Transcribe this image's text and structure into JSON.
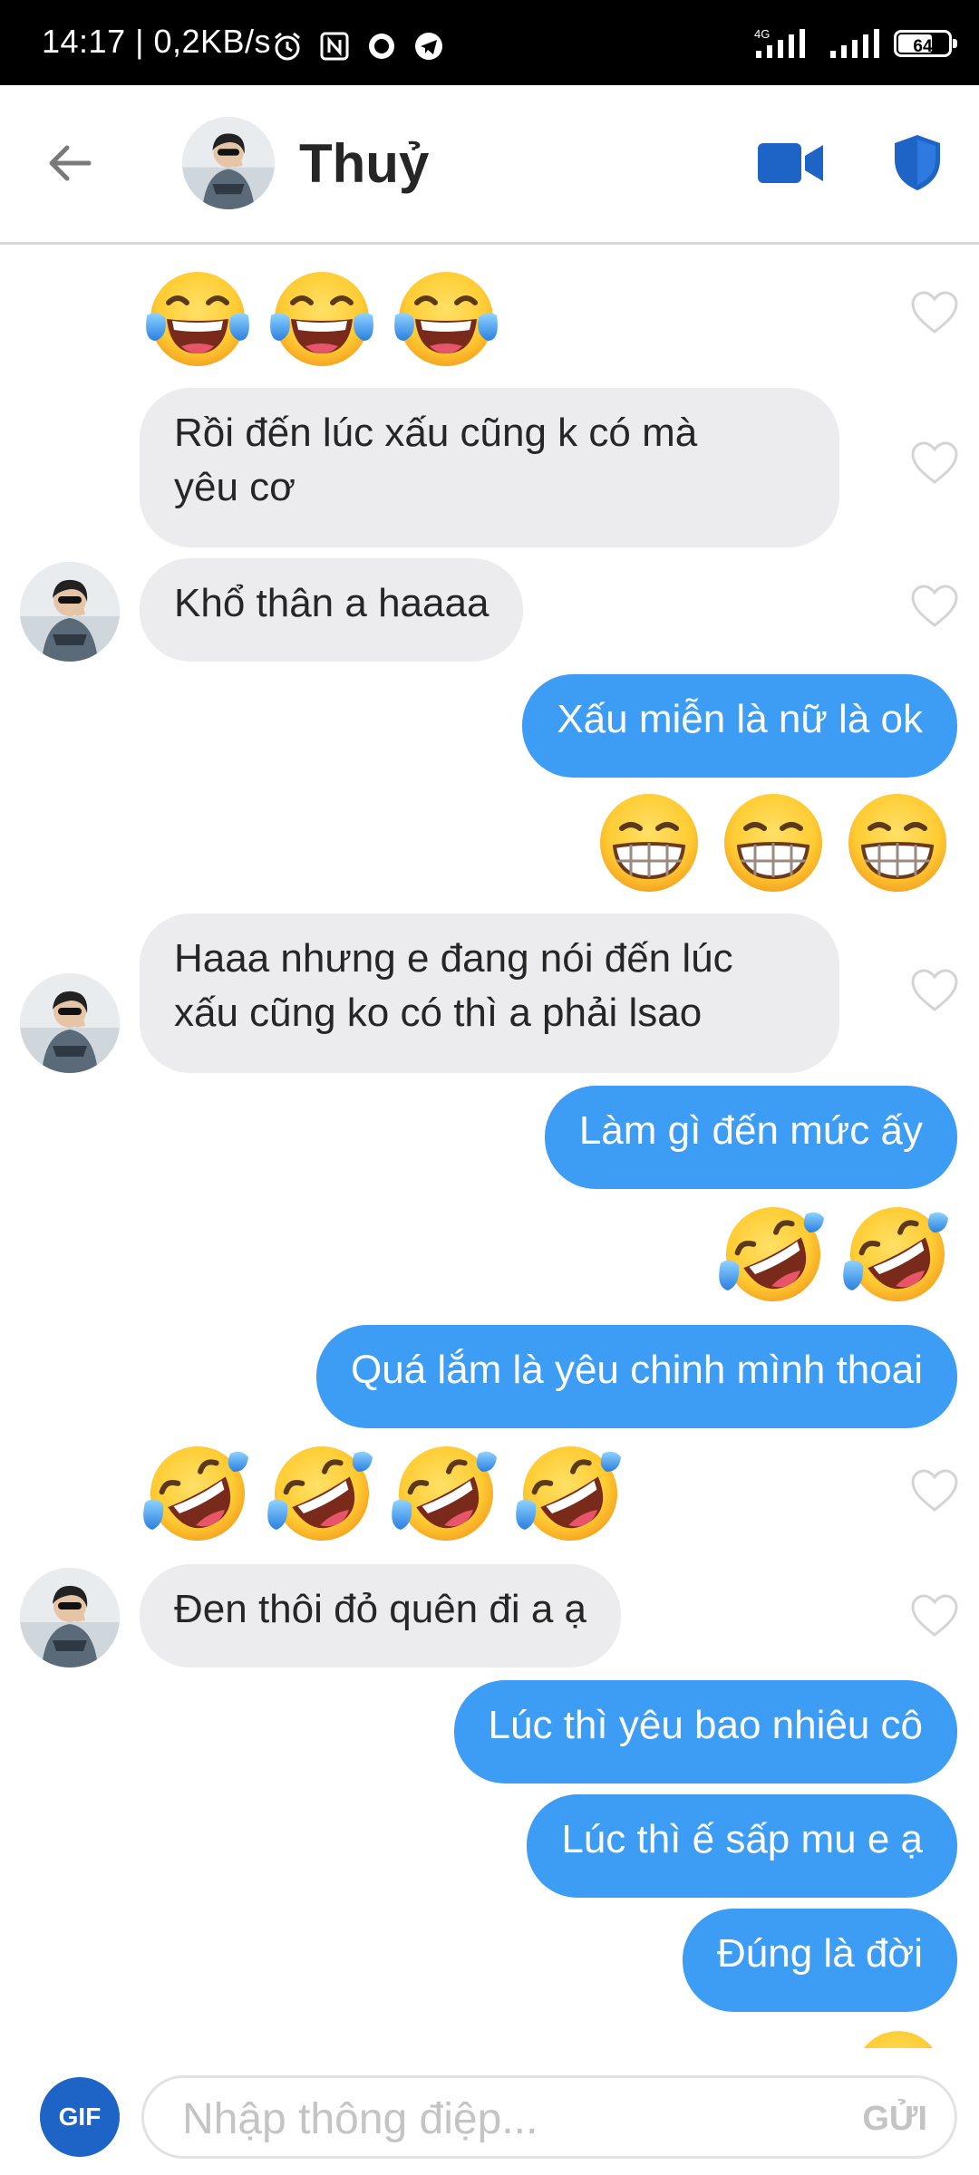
{
  "status_bar": {
    "time": "14:17 | 0,2KB/s",
    "network": "4G",
    "battery": "64",
    "icons": [
      "alarm-icon",
      "nfc-icon",
      "record-icon",
      "telegram-icon"
    ]
  },
  "header": {
    "name": "Thuỷ",
    "icons": [
      "back-arrow-icon",
      "video-call-icon",
      "shield-icon"
    ]
  },
  "colors": {
    "outgoing_bubble": "#3d9cf4",
    "incoming_bubble": "#ececee",
    "accent": "#1e63c6"
  },
  "messages": {
    "m0": {
      "emoji": "face-with-tears-of-joy",
      "count": 3
    },
    "m1": {
      "text": "Rồi đến lúc xấu cũng k có mà",
      "text2": "yêu cơ"
    },
    "m2": {
      "text": "Khổ thân a haaaa"
    },
    "m3": {
      "text": "Xấu miễn là nữ là ok"
    },
    "m4": {
      "emoji": "grinning-face",
      "count": 3
    },
    "m5": {
      "text": "Haaa nhưng e đang nói đến lúc",
      "text2": "xấu cũng ko có thì a phải lsao"
    },
    "m6": {
      "text": "Làm gì đến mức ấy"
    },
    "m7": {
      "emoji": "rolling-on-floor-laughing",
      "count": 2
    },
    "m8": {
      "text": "Quá lắm là yêu chinh mình thoai"
    },
    "m9": {
      "emoji": "rolling-on-floor-laughing",
      "count": 4
    },
    "m10": {
      "text": "Đen thôi đỏ quên đi a ạ"
    },
    "m11": {
      "text": "Lúc thì yêu bao nhiêu cô"
    },
    "m12": {
      "text": "Lúc thì ế sấp mu e ạ"
    },
    "m13": {
      "text": "Đúng là đời"
    }
  },
  "composer": {
    "gif_label": "GIF",
    "placeholder": "Nhập thông điệp...",
    "send_label": "GỬI"
  }
}
